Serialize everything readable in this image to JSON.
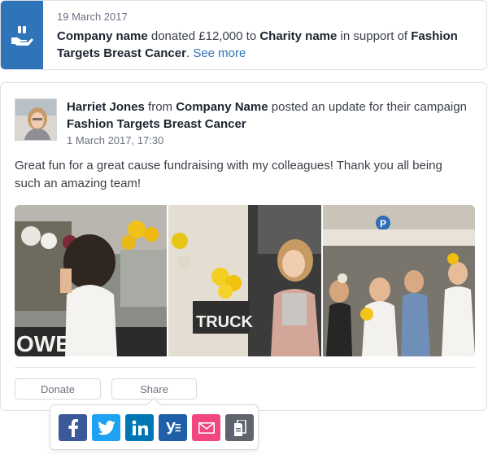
{
  "donation": {
    "date": "19 March 2017",
    "company": "Company name",
    "action": " donated £12,000 to ",
    "charity": "Charity name",
    "support": " in support of ",
    "campaign": "Fashion Targets Breast Cancer",
    "separator": ". ",
    "see_more": "See more"
  },
  "post": {
    "author": "Harriet Jones",
    "from": " from ",
    "company": "Company Name",
    "action": " posted an update for their campaign ",
    "campaign": "Fashion Targets Breast Cancer",
    "timestamp": "1 March 2017, 17:30",
    "body": "Great fun for a great cause fundraising with my colleagues! Thank you all being such an amazing team!"
  },
  "actions": {
    "donate_label": "Donate",
    "share_label": "Share"
  },
  "share": {
    "items": [
      {
        "icon": "facebook-icon",
        "glyph": "f",
        "color": "#3b5998"
      },
      {
        "icon": "twitter-icon",
        "glyph": "",
        "color": "#1da1f2"
      },
      {
        "icon": "linkedin-icon",
        "glyph": "in",
        "color": "#0077b5"
      },
      {
        "icon": "yammer-icon",
        "glyph": "y",
        "color": "#1f5fa8"
      },
      {
        "icon": "email-icon",
        "glyph": "",
        "color": "#f0487e"
      },
      {
        "icon": "copy-icon",
        "glyph": "",
        "color": "#5f656e"
      }
    ]
  },
  "colors": {
    "brand_blue": "#2f73b8",
    "text_dark": "#1d2430",
    "text_muted": "#6b7280"
  }
}
